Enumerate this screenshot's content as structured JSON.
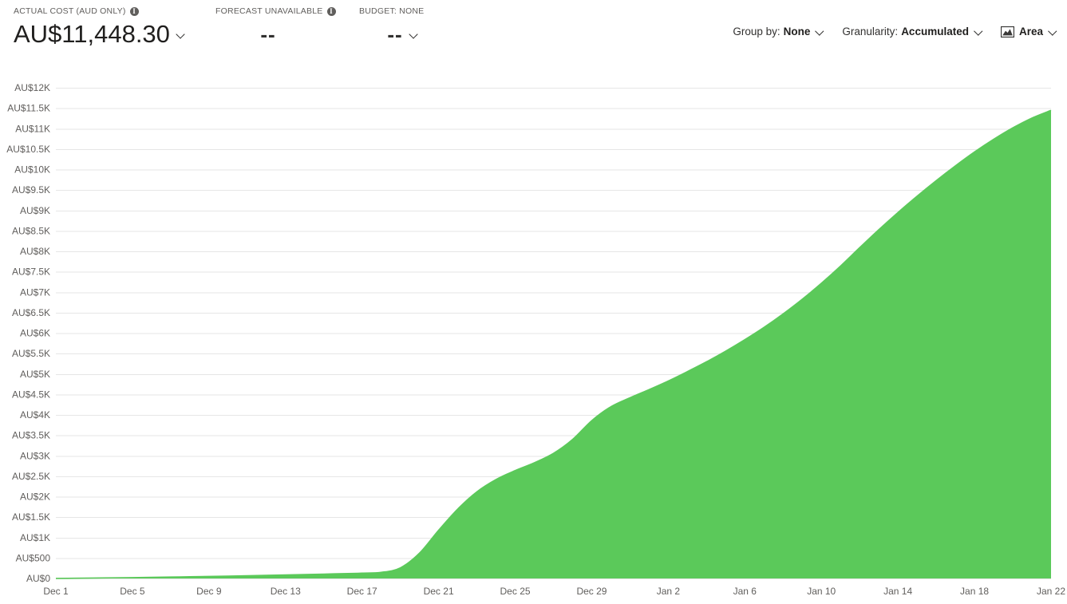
{
  "header": {
    "kpis": [
      {
        "id": "actual-cost",
        "label": "ACTUAL COST (AUD ONLY)",
        "value": "AU$11,448.30",
        "has_info_icon": true,
        "has_chevron": true
      },
      {
        "id": "forecast",
        "label": "FORECAST UNAVAILABLE",
        "value": "--",
        "has_info_icon": true,
        "has_chevron": false
      },
      {
        "id": "budget",
        "label": "BUDGET: NONE",
        "value": "--",
        "has_info_icon": false,
        "has_chevron": true
      }
    ]
  },
  "toolbar": {
    "group_by": {
      "prefix": "Group by:",
      "value": "None"
    },
    "granularity": {
      "prefix": "Granularity:",
      "value": "Accumulated"
    },
    "chart_type": {
      "icon": "area-chart-icon",
      "value": "Area"
    }
  },
  "colors": {
    "series_green": "#5BC95A",
    "gridline": "#e6e6e6",
    "tick_text": "#605e5c",
    "value_text": "#201f1e"
  },
  "chart_data": {
    "type": "area",
    "title": "",
    "xlabel": "",
    "ylabel": "",
    "grid": true,
    "legend": "none",
    "ylim": [
      0,
      12000
    ],
    "ytick_values": [
      0,
      500,
      1000,
      1500,
      2000,
      2500,
      3000,
      3500,
      4000,
      4500,
      5000,
      5500,
      6000,
      6500,
      7000,
      7500,
      8000,
      8500,
      9000,
      9500,
      10000,
      10500,
      11000,
      11500,
      12000
    ],
    "ytick_labels": [
      "AU$0",
      "AU$500",
      "AU$1K",
      "AU$1.5K",
      "AU$2K",
      "AU$2.5K",
      "AU$3K",
      "AU$3.5K",
      "AU$4K",
      "AU$4.5K",
      "AU$5K",
      "AU$5.5K",
      "AU$6K",
      "AU$6.5K",
      "AU$7K",
      "AU$7.5K",
      "AU$8K",
      "AU$8.5K",
      "AU$9K",
      "AU$9.5K",
      "AU$10K",
      "AU$10.5K",
      "AU$11K",
      "AU$11.5K",
      "AU$12K"
    ],
    "xtick_labels": [
      "Dec 1",
      "Dec 5",
      "Dec 9",
      "Dec 13",
      "Dec 17",
      "Dec 21",
      "Dec 25",
      "Dec 29",
      "Jan 2",
      "Jan 6",
      "Jan 10",
      "Jan 14",
      "Jan 18",
      "Jan 22"
    ],
    "series": [
      {
        "name": "Actual cost (accumulated)",
        "color": "#5BC95A",
        "x": [
          "Dec 1",
          "Dec 2",
          "Dec 3",
          "Dec 4",
          "Dec 5",
          "Dec 6",
          "Dec 7",
          "Dec 8",
          "Dec 9",
          "Dec 10",
          "Dec 11",
          "Dec 12",
          "Dec 13",
          "Dec 14",
          "Dec 15",
          "Dec 16",
          "Dec 17",
          "Dec 18",
          "Dec 19",
          "Dec 20",
          "Dec 21",
          "Dec 22",
          "Dec 23",
          "Dec 24",
          "Dec 25",
          "Dec 26",
          "Dec 27",
          "Dec 28",
          "Dec 29",
          "Dec 30",
          "Dec 31",
          "Jan 1",
          "Jan 2",
          "Jan 3",
          "Jan 4",
          "Jan 5",
          "Jan 6",
          "Jan 7",
          "Jan 8",
          "Jan 9",
          "Jan 10",
          "Jan 11",
          "Jan 12",
          "Jan 13",
          "Jan 14",
          "Jan 15",
          "Jan 16",
          "Jan 17",
          "Jan 18",
          "Jan 19",
          "Jan 20",
          "Jan 21",
          "Jan 22"
        ],
        "values": [
          2,
          6,
          11,
          16,
          22,
          28,
          35,
          42,
          50,
          58,
          67,
          76,
          86,
          96,
          107,
          118,
          130,
          150,
          260,
          620,
          1180,
          1700,
          2120,
          2420,
          2640,
          2830,
          3060,
          3400,
          3860,
          4200,
          4420,
          4620,
          4830,
          5060,
          5300,
          5560,
          5840,
          6140,
          6470,
          6830,
          7220,
          7640,
          8090,
          8530,
          8950,
          9350,
          9730,
          10090,
          10430,
          10740,
          11020,
          11260,
          11448.3
        ]
      }
    ]
  }
}
